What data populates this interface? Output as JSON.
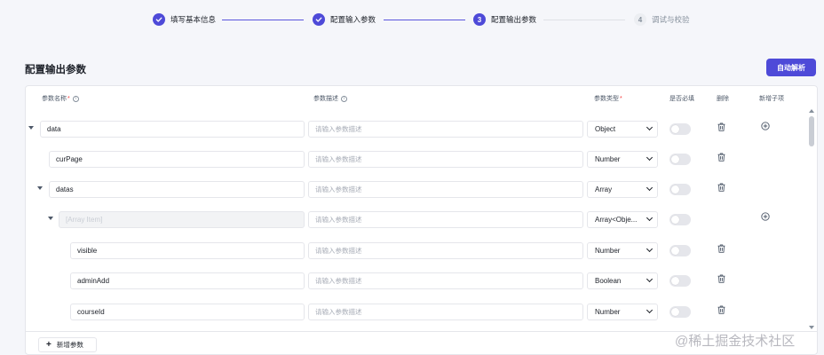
{
  "stepper": {
    "steps": [
      {
        "label": "填写基本信息",
        "state": "done"
      },
      {
        "label": "配置输入参数",
        "state": "done"
      },
      {
        "label": "配置输出参数",
        "state": "current",
        "number": "3"
      },
      {
        "label": "调试与校验",
        "state": "pending",
        "number": "4"
      }
    ]
  },
  "section": {
    "title": "配置输出参数",
    "auto_parse_label": "自动解析"
  },
  "table": {
    "headers": {
      "name": "参数名称",
      "desc": "参数描述",
      "type": "参数类型",
      "required": "是否必填",
      "delete": "删除",
      "add_child": "新增子项"
    },
    "required_mark": "*",
    "desc_placeholder": "请输入参数描述",
    "rows": [
      {
        "name": "data",
        "type": "Object"
      },
      {
        "name": "curPage",
        "type": "Number"
      },
      {
        "name": "datas",
        "type": "Array"
      },
      {
        "name": "[Array Item]",
        "type": "Array<Obje..."
      },
      {
        "name": "visible",
        "type": "Number"
      },
      {
        "name": "adminAdd",
        "type": "Boolean"
      },
      {
        "name": "courseId",
        "type": "Number"
      }
    ]
  },
  "footer": {
    "add_param_label": "新增参数"
  },
  "watermark": "@稀土掘金技术社区",
  "colors": {
    "primary": "#4e4ad8",
    "required_star": "#f53f3f",
    "border": "#e5e6eb"
  }
}
